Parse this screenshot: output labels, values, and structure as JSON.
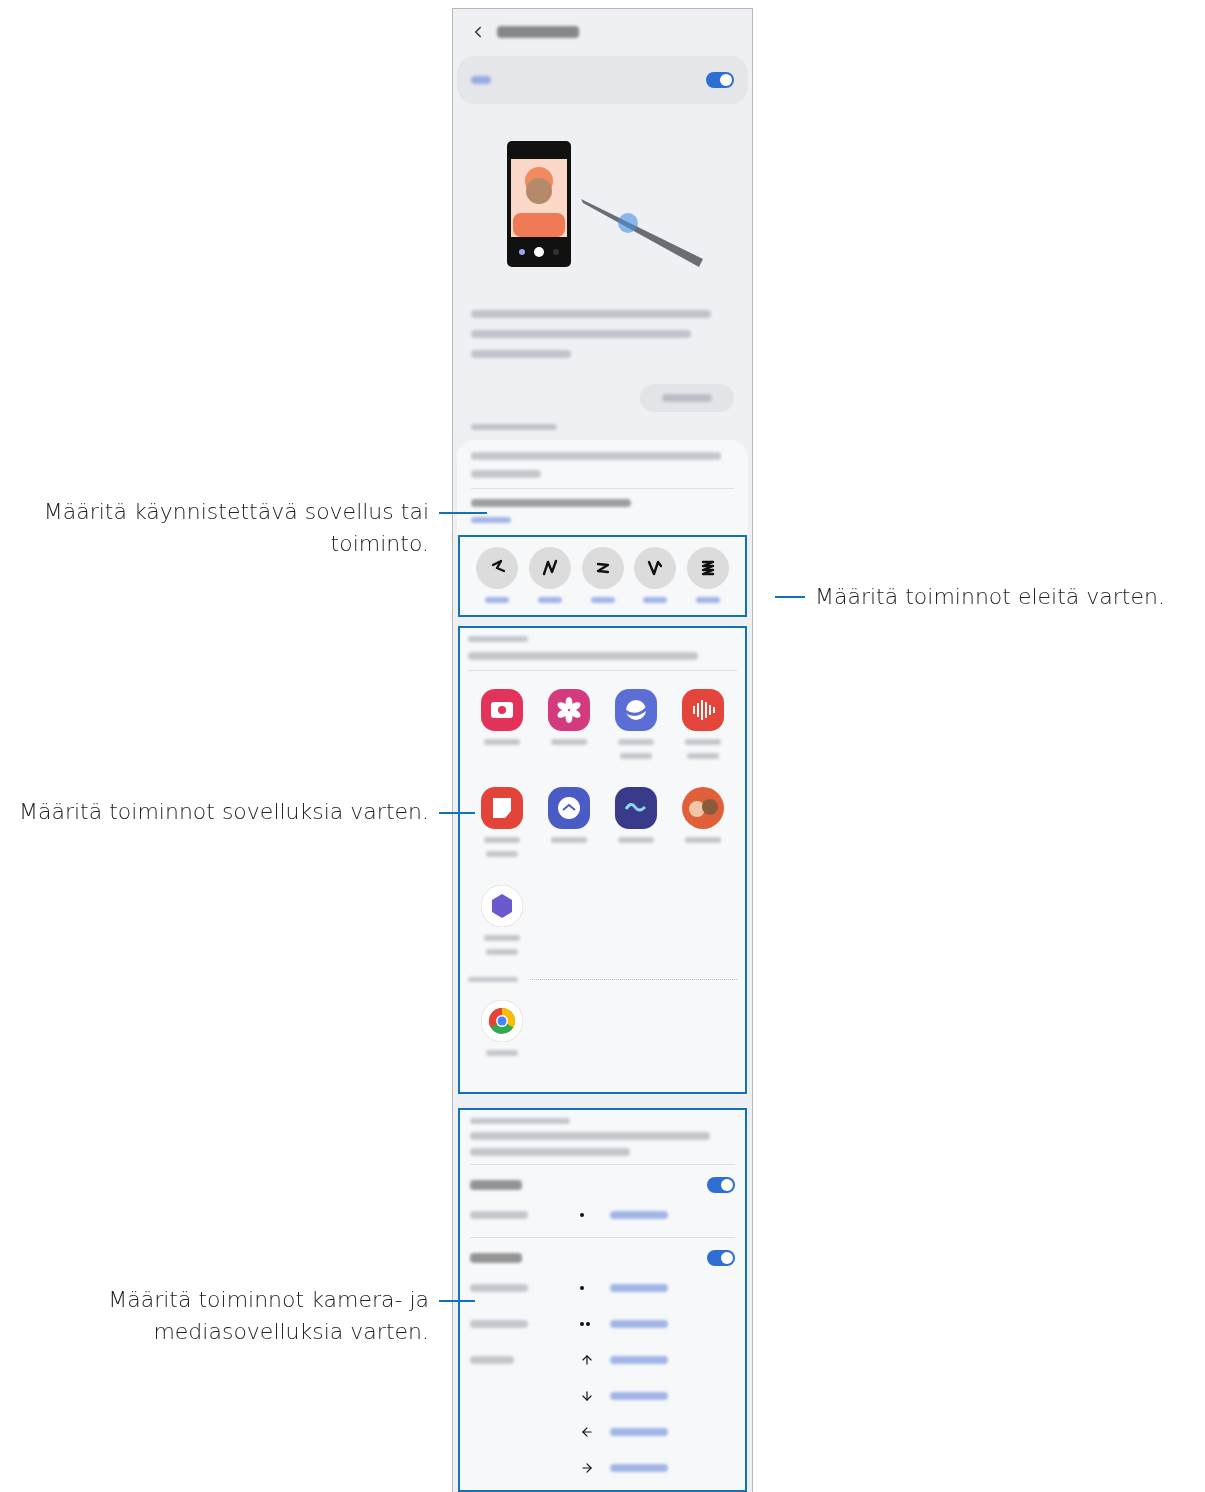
{
  "callouts": [
    {
      "text": "Määritä käynnistettävä sovellus tai toiminto.",
      "kind": "left"
    },
    {
      "text": "Määritä toiminnot eleitä varten.",
      "kind": "right"
    },
    {
      "text": "Määritä toiminnot sovelluksia varten.",
      "kind": "left"
    },
    {
      "text": "Määritä toiminnot kamera- ja mediasovelluksia varten.",
      "kind": "left"
    }
  ],
  "master_switch": {
    "on": true
  },
  "action_groups": [
    {
      "on": true,
      "rows": [
        {
          "kind": "press"
        }
      ]
    },
    {
      "on": true,
      "rows": [
        {
          "kind": "press"
        },
        {
          "kind": "double-press"
        },
        {
          "kind": "up"
        },
        {
          "kind": "down"
        },
        {
          "kind": "left"
        },
        {
          "kind": "right"
        }
      ]
    }
  ]
}
